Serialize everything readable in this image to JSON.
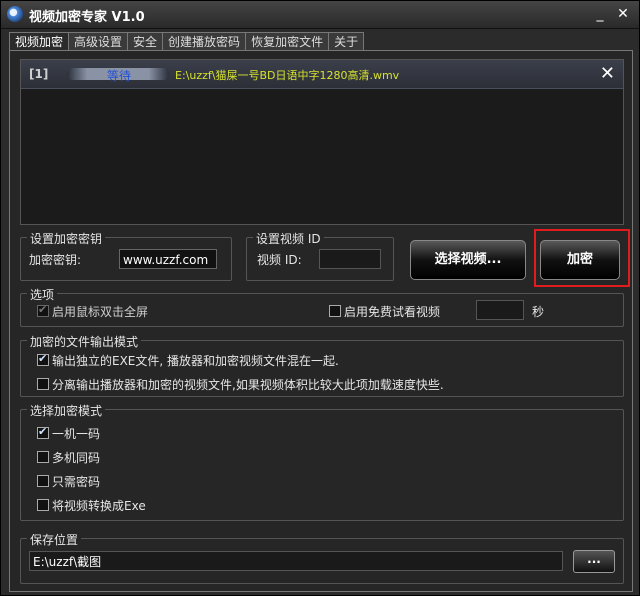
{
  "window": {
    "title": "视频加密专家 V1.0",
    "minimize": "_",
    "close": "✕"
  },
  "tabs": [
    {
      "label": "视频加密",
      "active": true
    },
    {
      "label": "高级设置"
    },
    {
      "label": "安全"
    },
    {
      "label": "创建播放密码"
    },
    {
      "label": "恢复加密文件"
    },
    {
      "label": "关于"
    }
  ],
  "file_list": {
    "rows": [
      {
        "index": "[1]",
        "status": "等待",
        "path": "E:\\uzzf\\猫屎一号BD日语中字1280高清.wmv",
        "remove": "✕"
      }
    ]
  },
  "key_group": {
    "title": "设置加密密钥",
    "label": "加密密钥:",
    "value": "www.uzzf.com"
  },
  "id_group": {
    "title": "设置视频 ID",
    "label": "视频 ID:",
    "value": ""
  },
  "buttons": {
    "select_video": "选择视频...",
    "encrypt": "加密",
    "browse": "..."
  },
  "options": {
    "title": "选项",
    "fullscreen": {
      "label": "启用鼠标双击全屏",
      "checked": true,
      "disabled": true
    },
    "trial": {
      "label": "启用免费试看视频",
      "checked": false,
      "seconds_value": "",
      "unit": "秒"
    }
  },
  "output_mode": {
    "title": "加密的文件输出模式",
    "items": [
      {
        "label": "输出独立的EXE文件, 播放器和加密视频文件混在一起.",
        "checked": true
      },
      {
        "label": "分离输出播放器和加密的视频文件,如果视频体积比较大此项加载速度快些.",
        "checked": false
      }
    ]
  },
  "encrypt_mode": {
    "title": "选择加密模式",
    "items": [
      {
        "label": "一机一码",
        "checked": true
      },
      {
        "label": "多机同码",
        "checked": false
      },
      {
        "label": "只需密码",
        "checked": false
      },
      {
        "label": "将视频转换成Exe",
        "checked": false
      }
    ]
  },
  "save": {
    "title": "保存位置",
    "path": "E:\\uzzf\\截图"
  }
}
